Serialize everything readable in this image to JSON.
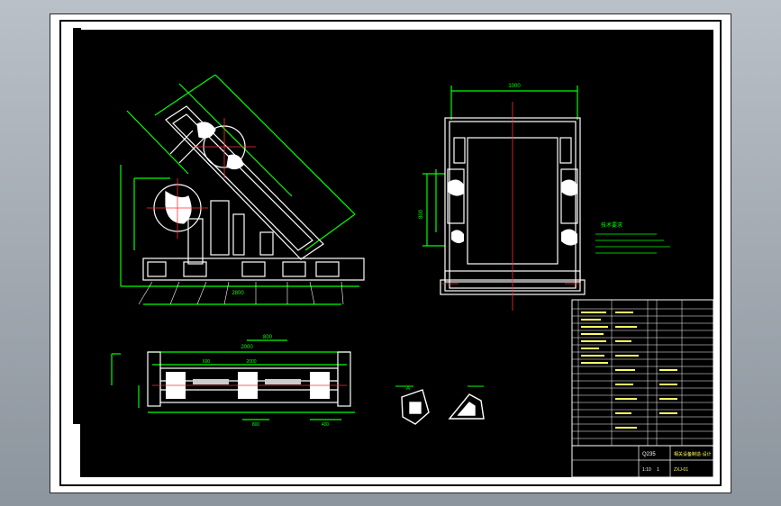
{
  "drawing": {
    "tech_notes_heading": "技术要求",
    "dimensions": {
      "top_width": "1000",
      "left_height": "800",
      "plan_span": "2000",
      "plan_sub": "800",
      "bottom_total": "2800",
      "bottom_a": "600",
      "bottom_b": "2000",
      "bottom_side": "400",
      "bottom_mid": "800"
    },
    "section_mark": "A"
  },
  "title_block": {
    "material": "Q235",
    "drawing_title": "相关设备制造·设计",
    "drawing_no": "ZXJ-01",
    "scale": "1:10",
    "sheet": "1"
  },
  "colors": {
    "outline": "#ffffff",
    "dimension": "#00ff00",
    "centerline": "#ff3030",
    "title_block_text": "#ffff66"
  }
}
